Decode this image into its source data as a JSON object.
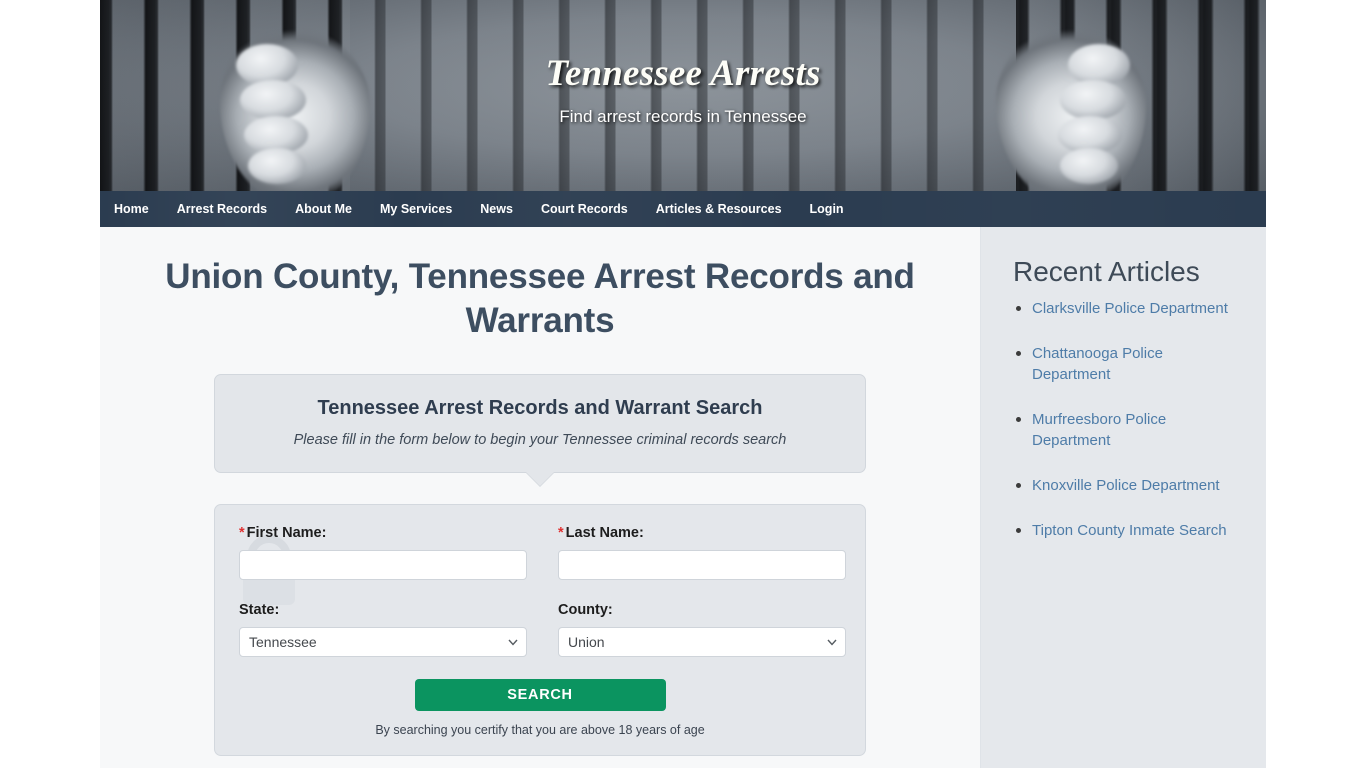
{
  "banner": {
    "title": "Tennessee Arrests",
    "tagline": "Find arrest records in Tennessee"
  },
  "nav": {
    "items": [
      {
        "label": "Home"
      },
      {
        "label": "Arrest Records"
      },
      {
        "label": "About Me"
      },
      {
        "label": "My Services"
      },
      {
        "label": "News"
      },
      {
        "label": "Court Records"
      },
      {
        "label": "Articles & Resources"
      },
      {
        "label": "Login"
      }
    ]
  },
  "main": {
    "page_title": "Union County, Tennessee Arrest Records and Warrants",
    "callout": {
      "title": "Tennessee Arrest Records and Warrant Search",
      "subtitle": "Please fill in the form below to begin your Tennessee criminal records search"
    },
    "form": {
      "first_name": {
        "label": "First Name:",
        "required_mark": "*",
        "value": "",
        "placeholder": ""
      },
      "last_name": {
        "label": "Last Name:",
        "required_mark": "*",
        "value": "",
        "placeholder": ""
      },
      "state": {
        "label": "State:",
        "selected": "Tennessee",
        "options": [
          "Tennessee"
        ]
      },
      "county": {
        "label": "County:",
        "selected": "Union",
        "options": [
          "Union"
        ]
      },
      "search_button": "SEARCH",
      "certify_text": "By searching you certify that you are above 18 years of age"
    }
  },
  "sidebar": {
    "title": "Recent Articles",
    "articles": [
      {
        "label": "Clarksville Police Department"
      },
      {
        "label": "Chattanooga Police Department"
      },
      {
        "label": "Murfreesboro Police Department"
      },
      {
        "label": "Knoxville Police Department"
      },
      {
        "label": "Tipton County Inmate Search"
      }
    ]
  },
  "colors": {
    "nav_bar": "#2b3c50",
    "title_text": "#3d4e61",
    "search_button": "#0b9460",
    "link": "#4e7ca8",
    "required_asterisk": "#e03131",
    "sidebar_bg": "#e5e8ec",
    "content_bg": "#f7f8f9"
  }
}
